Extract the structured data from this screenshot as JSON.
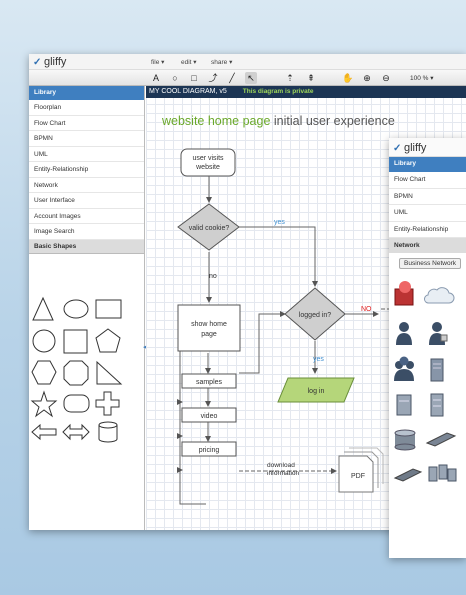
{
  "app": {
    "logo_text": "gliffy"
  },
  "menus": [
    {
      "label": "file ▾"
    },
    {
      "label": "edit ▾"
    },
    {
      "label": "share ▾"
    }
  ],
  "toolbar": {
    "zoom": "100 % ▾",
    "tools": [
      {
        "name": "text-tool-icon",
        "glyph": "A"
      },
      {
        "name": "ellipse-tool-icon",
        "glyph": "○"
      },
      {
        "name": "rectangle-tool-icon",
        "glyph": "□"
      },
      {
        "name": "connector-tool-icon",
        "glyph": "⤴"
      },
      {
        "name": "line-tool-icon",
        "glyph": "╱"
      },
      {
        "name": "pointer-tool-icon",
        "glyph": "↖"
      },
      {
        "name": "bring-front-icon",
        "glyph": "⇡"
      },
      {
        "name": "send-back-icon",
        "glyph": "⇞"
      },
      {
        "name": "pan-hand-icon",
        "glyph": "✋"
      },
      {
        "name": "zoom-in-icon",
        "glyph": "⊕"
      },
      {
        "name": "zoom-out-icon",
        "glyph": "⊖"
      },
      {
        "name": "grid-icon",
        "glyph": "⊞"
      }
    ]
  },
  "sidebar": {
    "header": "Library",
    "items": [
      "Floorplan",
      "Flow Chart",
      "BPMN",
      "UML",
      "Entity-Relationship",
      "Network",
      "User Interface",
      "Account Images",
      "Image Search"
    ],
    "section": "Basic Shapes"
  },
  "canvas": {
    "title": "MY COOL DIAGRAM, v5",
    "privacy": "This diagram is private",
    "diagram_title_highlight": "website home page",
    "diagram_title_rest": " initial user experience"
  },
  "flowchart": {
    "start": [
      "user visits",
      "website"
    ],
    "cookie": "valid cookie?",
    "yes1": "yes",
    "no1": "no",
    "show_home": [
      "show home",
      "page"
    ],
    "logged_in": "logged in?",
    "no2": "NO",
    "yes2": "yes",
    "log_in": "log in",
    "samples": "samples",
    "video": "video",
    "pricing": "pricing",
    "download": [
      "download",
      "information"
    ],
    "pdf": "PDF"
  },
  "second_window": {
    "logo_text": "gliffy",
    "header": "Library",
    "items": [
      "Flow Chart",
      "BPMN",
      "UML",
      "Entity-Relationship"
    ],
    "section": "Network",
    "button": "Business Network"
  },
  "colors": {
    "accent": "#3f7fc0",
    "highlight_green": "#6aa82a",
    "shape_gray": "#cfcfcf",
    "login_green": "#b5d67a",
    "no_red": "#e02020",
    "yes_blue": "#3f8fd0"
  }
}
